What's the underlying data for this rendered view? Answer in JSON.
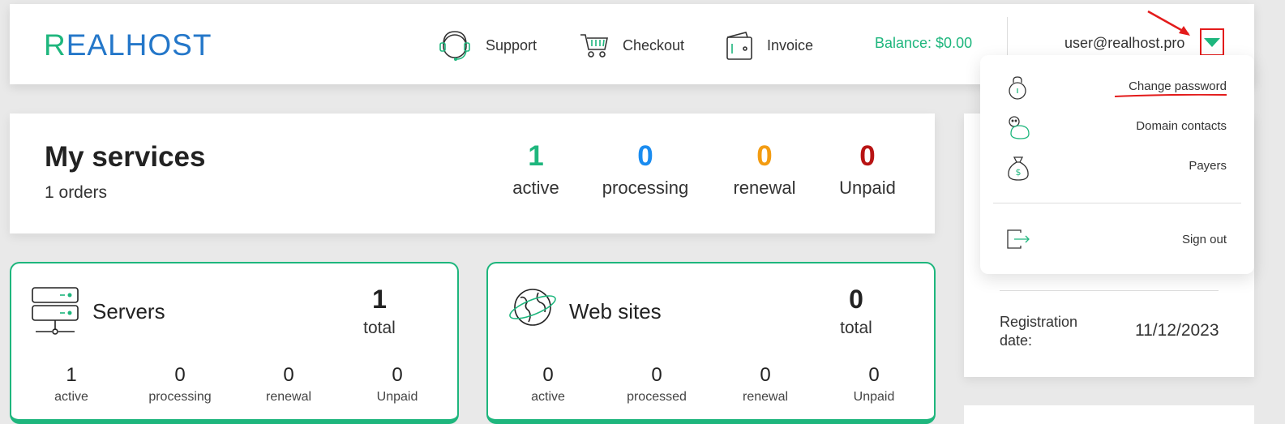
{
  "header": {
    "logo": {
      "first": "R",
      "rest": "EALHOST"
    },
    "nav": [
      {
        "label": "Support",
        "icon": "support-headset-icon"
      },
      {
        "label": "Checkout",
        "icon": "cart-icon"
      },
      {
        "label": "Invoice",
        "icon": "wallet-icon"
      }
    ],
    "balance": "Balance: $0.00",
    "user_email": "user@realhost.pro",
    "dropdown_icon": "chevron-down-icon"
  },
  "dropdown_menu": {
    "items": [
      {
        "label": "Change password",
        "icon": "lock-icon"
      },
      {
        "label": "Domain contacts",
        "icon": "contacts-icon"
      },
      {
        "label": "Payers",
        "icon": "money-bag-icon"
      },
      {
        "label": "Sign out",
        "icon": "sign-out-icon"
      }
    ]
  },
  "services": {
    "title": "My services",
    "orders": "1 orders",
    "stats": [
      {
        "value": "1",
        "label": "active",
        "color": "#1eb67d"
      },
      {
        "value": "0",
        "label": "processing",
        "color": "#1a8cf0"
      },
      {
        "value": "0",
        "label": "renewal",
        "color": "#f39c12"
      },
      {
        "value": "0",
        "label": "Unpaid",
        "color": "#b81414"
      }
    ]
  },
  "cards": [
    {
      "title": "Servers",
      "icon": "server-icon",
      "total": "1",
      "total_label": "total",
      "stats": [
        {
          "value": "1",
          "label": "active"
        },
        {
          "value": "0",
          "label": "processing"
        },
        {
          "value": "0",
          "label": "renewal"
        },
        {
          "value": "0",
          "label": "Unpaid"
        }
      ]
    },
    {
      "title": "Web sites",
      "icon": "globe-icon",
      "total": "0",
      "total_label": "total",
      "stats": [
        {
          "value": "0",
          "label": "active"
        },
        {
          "value": "0",
          "label": "processed"
        },
        {
          "value": "0",
          "label": "renewal"
        },
        {
          "value": "0",
          "label": "Unpaid"
        }
      ]
    }
  ],
  "account": {
    "registration_label": "Registration date:",
    "registration_date": "11/12/2023"
  },
  "colors": {
    "accent": "#1eb67d",
    "brand_blue": "#2477c9",
    "annotation_red": "#e31b1b"
  }
}
